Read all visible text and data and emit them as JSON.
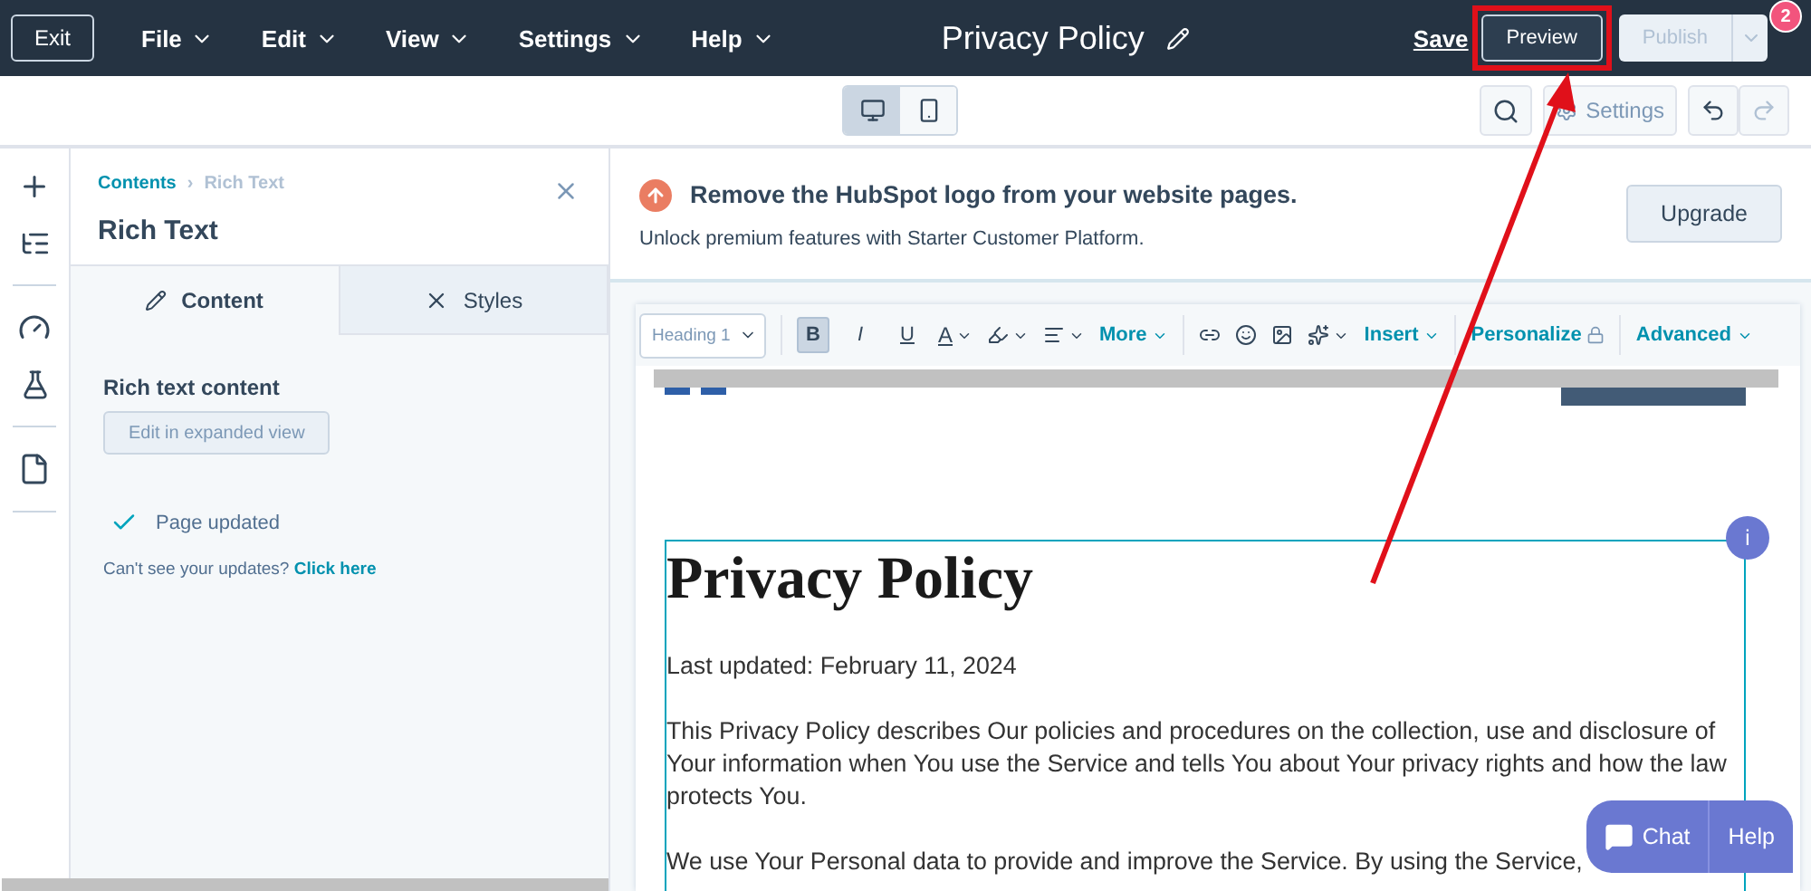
{
  "menu": {
    "exit": "Exit",
    "items": [
      "File",
      "Edit",
      "View",
      "Settings",
      "Help"
    ]
  },
  "page_title": "Privacy Policy",
  "actions": {
    "save": "Save",
    "preview": "Preview",
    "publish": {
      "label": "Publish",
      "disabled": true
    },
    "badge": "2"
  },
  "device_toggle": [
    {
      "kind": "desktop",
      "selected": true
    },
    {
      "kind": "mobile",
      "selected": false
    }
  ],
  "view_toolbar": {
    "settings": "Settings"
  },
  "sidebar": {
    "breadcrumb": [
      "Contents",
      "›",
      "Rich Text"
    ],
    "title": "Rich Text",
    "tabs": [
      {
        "kind": "content",
        "label": "Content",
        "selected": true
      },
      {
        "kind": "styles",
        "label": "Styles",
        "selected": false
      }
    ],
    "field_label": "Rich text content",
    "edit_button": "Edit in expanded view",
    "status": "Page updated",
    "hint": "Can't see your updates?",
    "hint_link": "Click here"
  },
  "banner": {
    "title": "Remove the HubSpot logo from your website pages.",
    "subtitle": "Unlock premium features with Starter Customer Platform.",
    "button": "Upgrade"
  },
  "editor_toolbar": {
    "style_select": "Heading 1",
    "formats": [
      {
        "kind": "bold",
        "label": "B",
        "selected": true
      },
      {
        "kind": "italic",
        "label": "I",
        "selected": false
      },
      {
        "kind": "underline",
        "label": "U",
        "selected": false
      }
    ],
    "text_color_label": "A",
    "more": "More",
    "insert": "Insert",
    "personalize": "Personalize",
    "advanced": "Advanced"
  },
  "document": {
    "heading": "Privacy Policy",
    "info": "i",
    "paragraphs": [
      "Last updated: February 11, 2024",
      "This Privacy Policy describes Our policies and procedures on the collection, use and disclosure of Your information when You use the Service and tells You about Your privacy rights and how the law protects You.",
      "We use Your Personal data to provide and improve the Service. By using the Service,"
    ]
  },
  "chat": {
    "chat": "Chat",
    "help": "Help"
  }
}
